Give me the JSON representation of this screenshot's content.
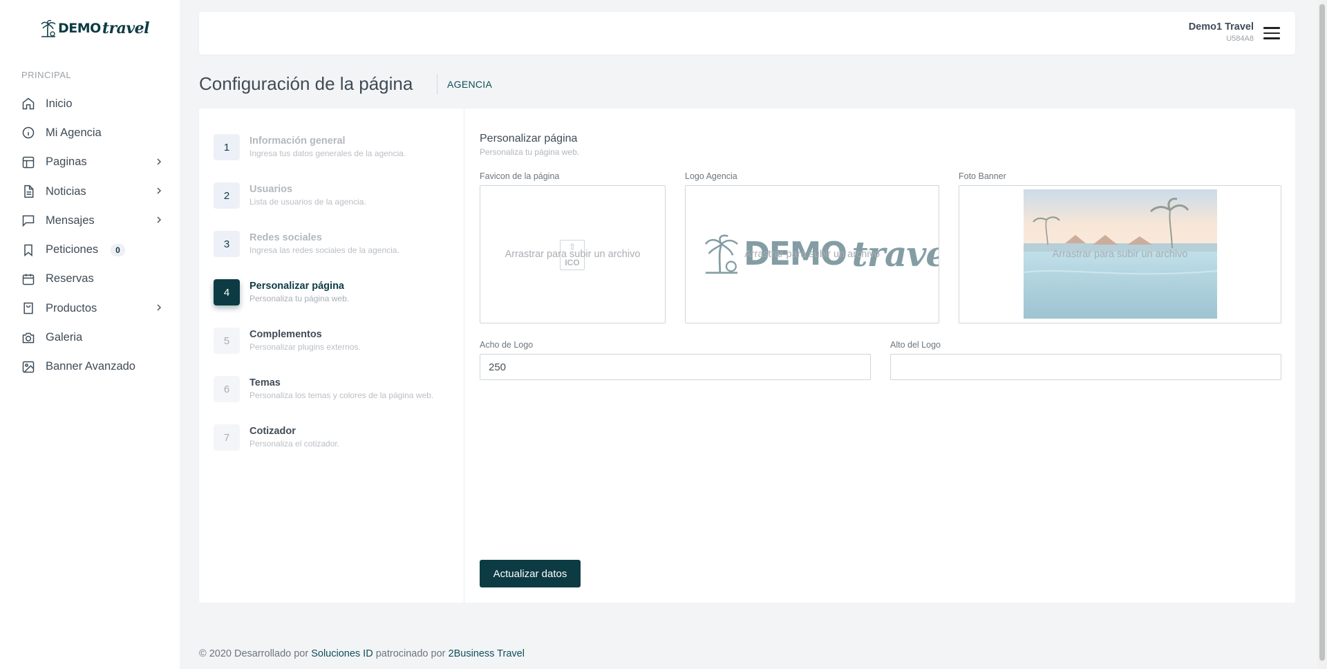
{
  "brand": {
    "demo": "DEMO",
    "travel": "travel"
  },
  "sidebar": {
    "heading": "PRINCIPAL",
    "items": [
      {
        "label": "Inicio",
        "icon": "home-icon",
        "has_submenu": false
      },
      {
        "label": "Mi Agencia",
        "icon": "info-icon",
        "has_submenu": false
      },
      {
        "label": "Paginas",
        "icon": "layout-icon",
        "has_submenu": true
      },
      {
        "label": "Noticias",
        "icon": "file-text-icon",
        "has_submenu": true
      },
      {
        "label": "Mensajes",
        "icon": "message-icon",
        "has_submenu": true
      },
      {
        "label": "Peticiones",
        "icon": "bookmark-icon",
        "has_submenu": false,
        "badge": "0"
      },
      {
        "label": "Reservas",
        "icon": "calendar-icon",
        "has_submenu": false
      },
      {
        "label": "Productos",
        "icon": "shopping-bag-icon",
        "has_submenu": true
      },
      {
        "label": "Galeria",
        "icon": "camera-icon",
        "has_submenu": false
      },
      {
        "label": "Banner Avanzado",
        "icon": "image-icon",
        "has_submenu": false
      }
    ]
  },
  "header": {
    "user_name": "Demo1 Travel",
    "user_code": "U584A8"
  },
  "page": {
    "title": "Configuración de la página",
    "breadcrumb": "AGENCIA"
  },
  "steps": [
    {
      "num": "1",
      "title": "Información general",
      "subtitle": "Ingresa tus datos generales de la agencia.",
      "state": "done"
    },
    {
      "num": "2",
      "title": "Usuarios",
      "subtitle": "Lista de usuarios de la agencia.",
      "state": "done"
    },
    {
      "num": "3",
      "title": "Redes sociales",
      "subtitle": "Ingresa las redes sociales de la agencia.",
      "state": "done"
    },
    {
      "num": "4",
      "title": "Personalizar página",
      "subtitle": "Personaliza tu página web.",
      "state": "active"
    },
    {
      "num": "5",
      "title": "Complementos",
      "subtitle": "Personalizar plugins externos.",
      "state": "future"
    },
    {
      "num": "6",
      "title": "Temas",
      "subtitle": "Personaliza los temas y colores de la página web.",
      "state": "future"
    },
    {
      "num": "7",
      "title": "Cotizador",
      "subtitle": "Personaliza el cotizador.",
      "state": "future"
    }
  ],
  "form": {
    "section_title": "Personalizar página",
    "section_subtitle": "Personaliza tu página web.",
    "favicon_label": "Favicon de la página",
    "favicon_file_type": "ICO",
    "logo_label": "Logo Agencia",
    "logo_demo": "DEMO",
    "logo_travel": "travel",
    "banner_label": "Foto Banner",
    "dropzone_text": "Arrastrar para subir un archivo",
    "logo_width_label": "Acho de Logo",
    "logo_width_value": "250",
    "logo_height_label": "Alto del Logo",
    "logo_height_value": "",
    "submit_label": "Actualizar datos"
  },
  "footer": {
    "prefix": "© 2020 Desarrollado por ",
    "link1": "Soluciones ID",
    "middle": " patrocinado por ",
    "link2": "2Business Travel"
  },
  "colors": {
    "primary": "#0d3b44",
    "badge_bg": "#eef0f6",
    "background": "#f3f4f6"
  }
}
